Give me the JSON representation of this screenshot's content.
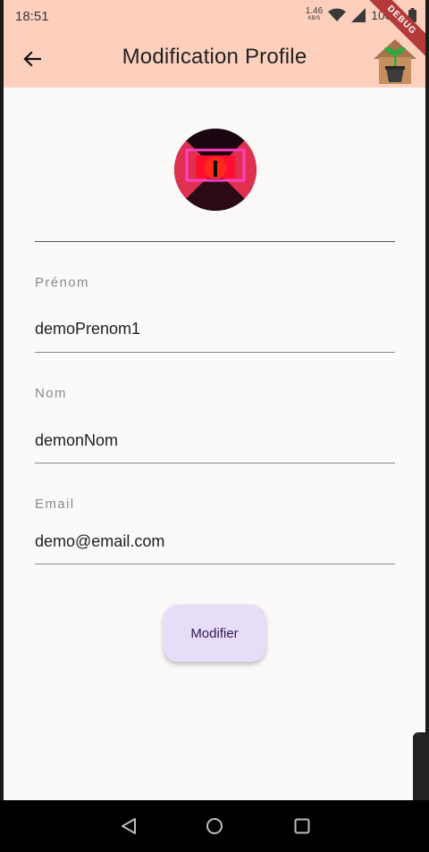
{
  "status_bar": {
    "time": "18:51",
    "net_speed_value": "1.46",
    "net_speed_unit": "KB/S",
    "battery": "100%"
  },
  "app_bar": {
    "title": "Modification Profile",
    "debug_label": "DEBUG"
  },
  "form": {
    "fields": [
      {
        "label": "Prénom",
        "value": "demoPrenom1"
      },
      {
        "label": "Nom",
        "value": "demonNom"
      },
      {
        "label": "Email",
        "value": "demo@email.com"
      }
    ],
    "submit_label": "Modifier"
  },
  "colors": {
    "app_bar": "#fcd0bd",
    "background": "#fcfaf9",
    "button": "#e8ddf8",
    "button_text": "#2d1a52"
  },
  "icons": {
    "back": "arrow-left-icon",
    "logo": "house-plant-logo",
    "nav_back": "triangle-back-icon",
    "nav_home": "circle-home-icon",
    "nav_recents": "square-recents-icon"
  }
}
